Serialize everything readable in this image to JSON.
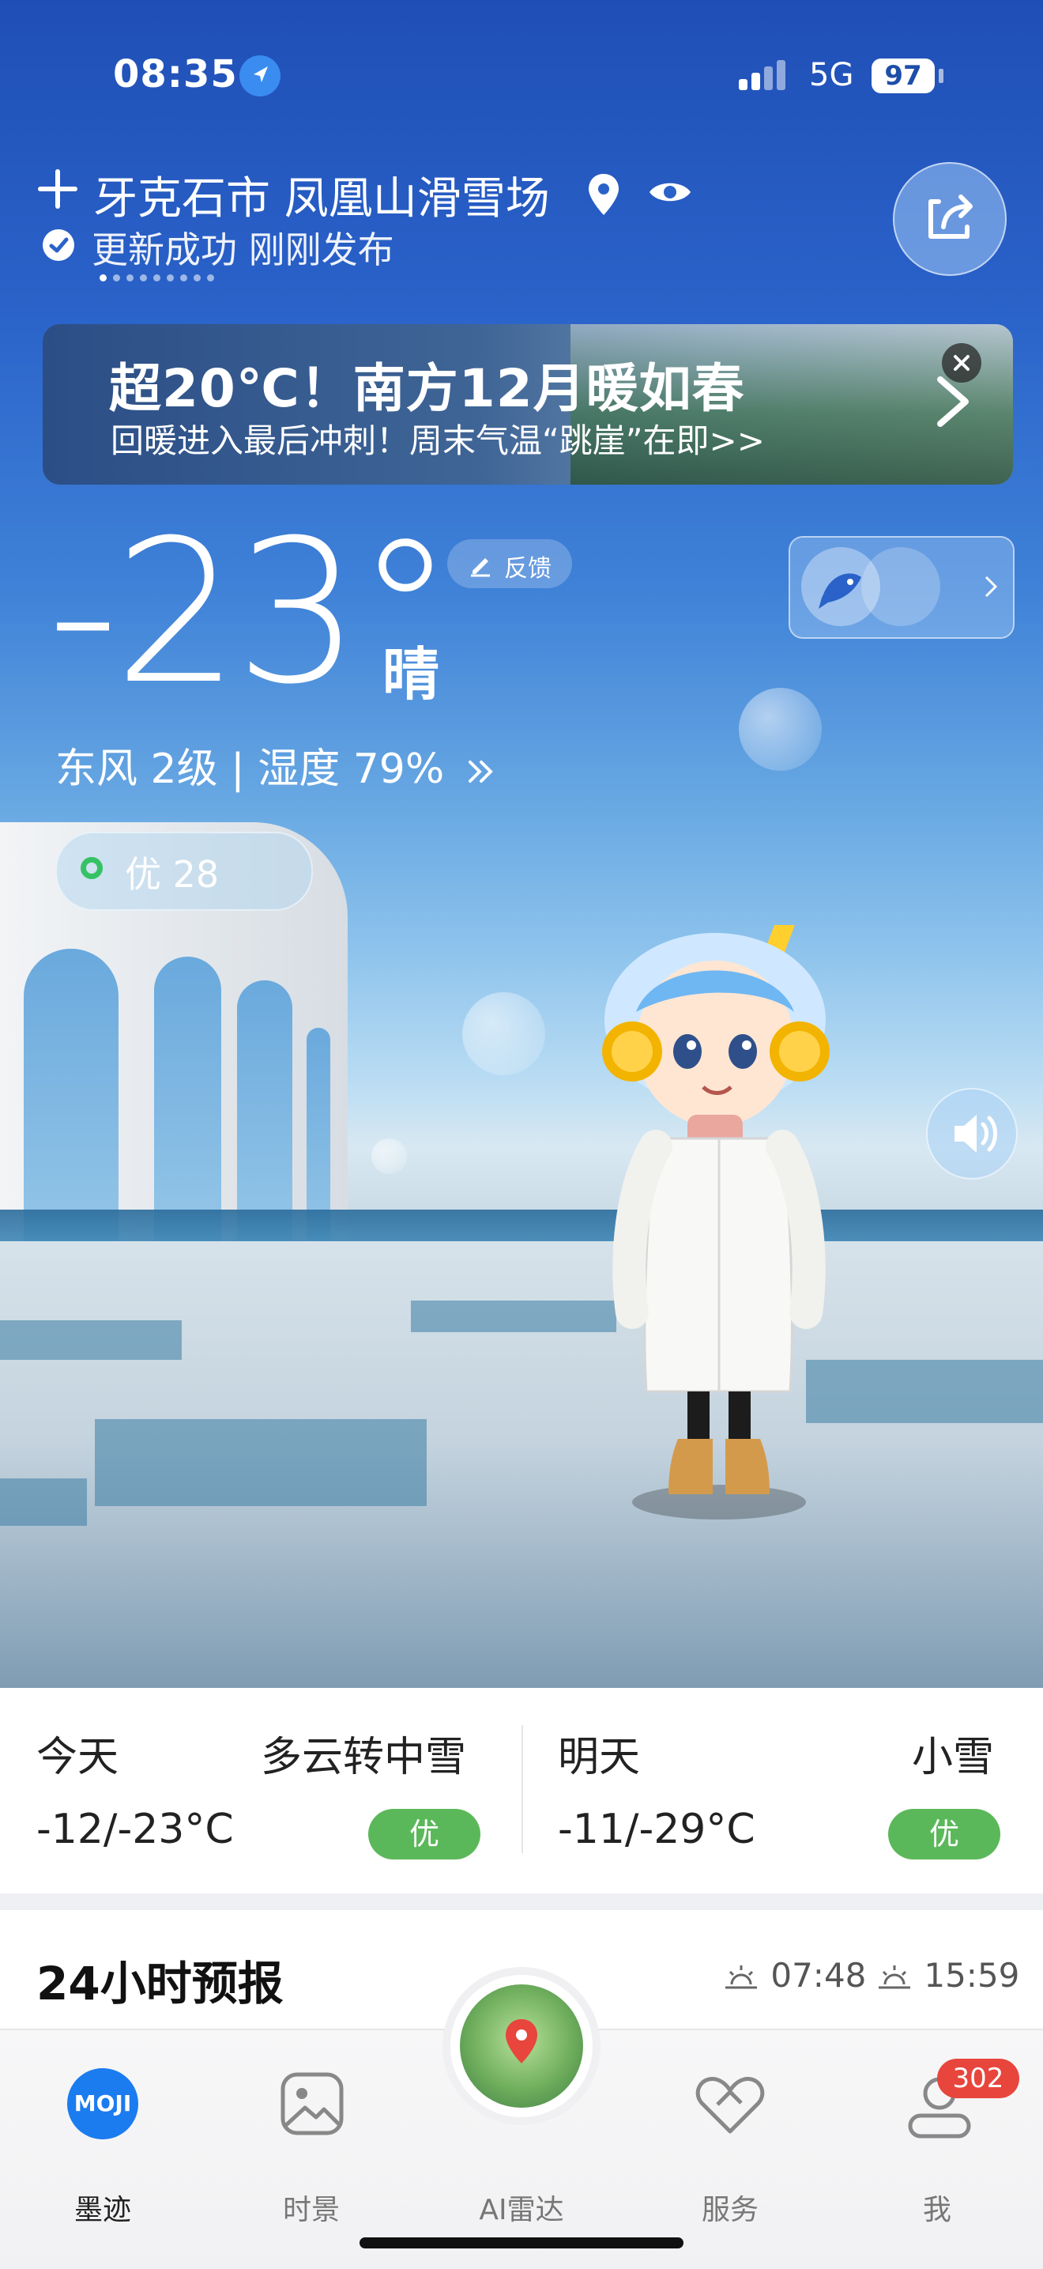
{
  "status_bar": {
    "time": "08:35",
    "network": "5G",
    "battery": "97"
  },
  "location": {
    "city": "牙克石市 凤凰山滑雪场",
    "update_status": "更新成功 刚刚发布"
  },
  "banner": {
    "title": "超20℃！南方12月暖如春",
    "subtitle": "回暖进入最后冲刺！周末气温“跳崖”在即>>"
  },
  "current": {
    "temperature": "-23°",
    "condition": "晴",
    "feedback_label": "反馈",
    "wind_humidity": "东风 2级 | 湿度 79%",
    "aqi": "优 28"
  },
  "daily": {
    "today": {
      "label": "今天",
      "condition": "多云转中雪",
      "range": "-12/-23°C",
      "aq": "优"
    },
    "tomorrow": {
      "label": "明天",
      "condition": "小雪",
      "range": "-11/-29°C",
      "aq": "优"
    }
  },
  "hourly": {
    "title": "24小时预报",
    "sunrise": "07:48",
    "sunset": "15:59"
  },
  "tabbar": {
    "items": [
      {
        "label": "墨迹",
        "icon": "moji-logo-icon"
      },
      {
        "label": "时景",
        "icon": "photo-icon"
      },
      {
        "label": "AI雷达",
        "icon": "radar-map-icon"
      },
      {
        "label": "服务",
        "icon": "service-heart-icon"
      },
      {
        "label": "我",
        "icon": "profile-icon"
      }
    ],
    "profile_badge": "302",
    "moji_logo_text": "MOJI"
  },
  "colors": {
    "accent_blue": "#2a62c9",
    "aqi_green": "#5bb85a",
    "badge_red": "#e8453c"
  }
}
